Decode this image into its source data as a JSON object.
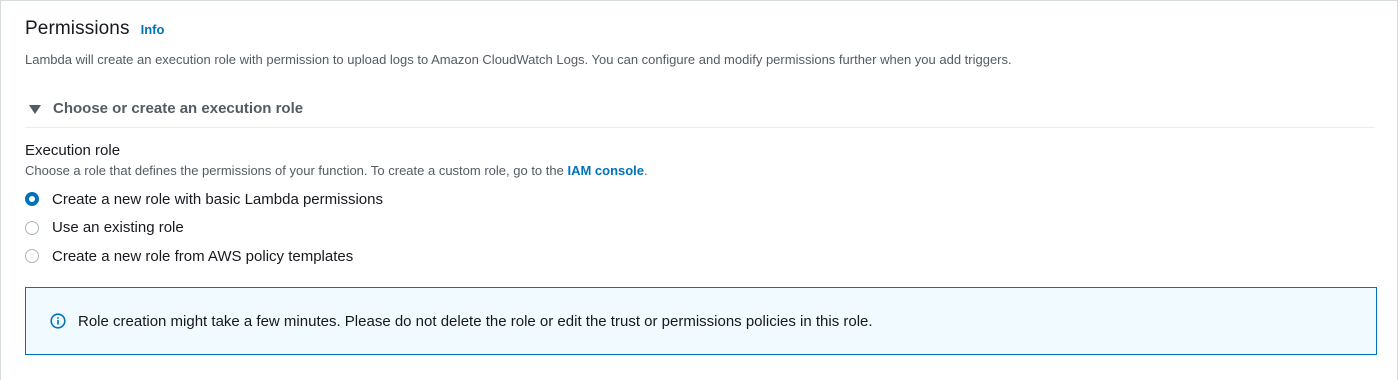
{
  "section": {
    "title": "Permissions",
    "info_link": "Info",
    "description": "Lambda will create an execution role with permission to upload logs to Amazon CloudWatch Logs. You can configure and modify permissions further when you add triggers."
  },
  "expander": {
    "label": "Choose or create an execution role",
    "expanded": true,
    "icon": "caret-down-icon"
  },
  "execution_role": {
    "label": "Execution role",
    "description_prefix": "Choose a role that defines the permissions of your function. To create a custom role, go to the ",
    "description_link": "IAM console",
    "description_suffix": ".",
    "options": [
      {
        "label": "Create a new role with basic Lambda permissions",
        "checked": true
      },
      {
        "label": "Use an existing role",
        "checked": false
      },
      {
        "label": "Create a new role from AWS policy templates",
        "checked": false
      }
    ]
  },
  "alert": {
    "icon": "info-circle-icon",
    "text": "Role creation might take a few minutes. Please do not delete the role or edit the trust or permissions policies in this role."
  },
  "colors": {
    "accent": "#0073bb",
    "alert_bg": "#f1faff",
    "text": "#16191f",
    "secondary_text": "#545b64",
    "border": "#d5dbdb"
  }
}
